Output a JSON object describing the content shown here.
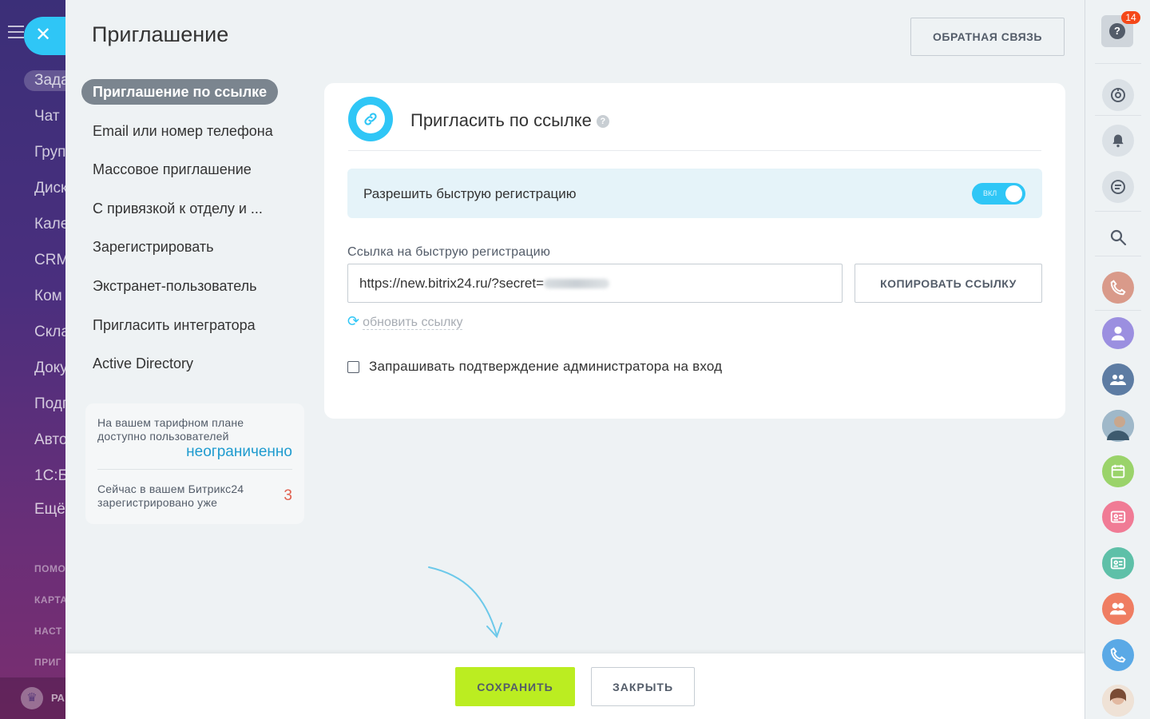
{
  "background_menu": {
    "items": [
      "Зада",
      "Чат",
      "Груп",
      "Диск",
      "Кале",
      "CRM",
      "Ком",
      "Скла",
      "Доку",
      "Подп",
      "Авто",
      "1С:Б",
      "Ещё"
    ],
    "sub_items": [
      "ПОМО",
      "КАРТА",
      "НАСТ",
      "ПРИГ"
    ],
    "bottom_label": "РА"
  },
  "page_title": "Приглашение",
  "feedback_button": "ОБРАТНАЯ СВЯЗЬ",
  "nav": {
    "items": [
      "Приглашение по ссылке",
      "Email или номер телефона",
      "Массовое приглашение",
      "С привязкой к отделу и ...",
      "Зарегистрировать",
      "Экстранет-пользователь",
      "Пригласить интегратора",
      "Active Directory"
    ]
  },
  "info": {
    "plan_text": "На вашем тарифном плане доступно пользователей",
    "plan_value": "неограниченно",
    "registered_text": "Сейчас в вашем Битрикс24 зарегистрировано уже",
    "registered_count": "3"
  },
  "card": {
    "title": "Пригласить по ссылке",
    "help_glyph": "?",
    "fast_reg_label": "Разрешить быструю регистрацию",
    "toggle_label": "ВКЛ",
    "toggle_on": true,
    "link_label": "Ссылка на быструю регистрацию",
    "link_value": "https://new.bitrix24.ru/?secret=",
    "copy_button": "КОПИРОВАТЬ ССЫЛКУ",
    "refresh_link": "обновить ссылку",
    "admin_confirm_label": "Запрашивать подтверждение администратора на вход"
  },
  "footer": {
    "save": "СОХРАНИТЬ",
    "close": "ЗАКРЫТЬ"
  },
  "rightbar": {
    "help_glyph": "?",
    "badge": "14",
    "colors": {
      "accent": "#2fc6f6",
      "save": "#bbed21"
    }
  }
}
